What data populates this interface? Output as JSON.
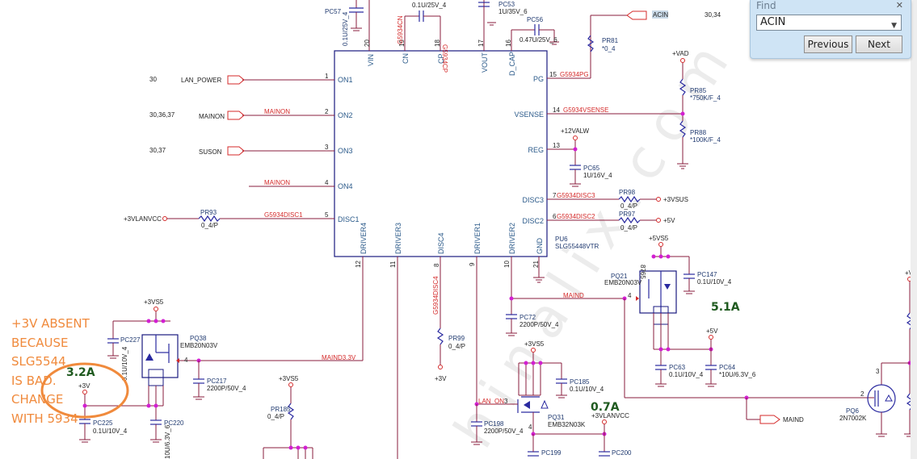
{
  "find_dialog": {
    "title": "Find",
    "close_label": "✕",
    "query": "ACIN",
    "dropdown_glyph": "▼",
    "previous_label": "Previous",
    "next_label": "Next"
  },
  "annotation": {
    "lines": [
      "+3V ABSENT",
      "BECAUSE",
      "SLG5544",
      "IS BAD.",
      "CHANGE",
      "WITH 5934"
    ],
    "accent_color": "#f08a3c"
  },
  "currents": {
    "pq38": "3.2A",
    "pq21": "5.1A",
    "pq31": "0.7A"
  },
  "ic": {
    "ref": "PU6",
    "part": "SLG55448VTR",
    "left_pins": [
      {
        "num": "1",
        "name": "ON1"
      },
      {
        "num": "2",
        "name": "ON2"
      },
      {
        "num": "3",
        "name": "ON3"
      },
      {
        "num": "4",
        "name": "ON4"
      },
      {
        "num": "5",
        "name": "DISC1"
      }
    ],
    "top_pins": [
      {
        "num": "20",
        "name": "VIN"
      },
      {
        "num": "19",
        "name": "CN"
      },
      {
        "num": "18",
        "name": "CP"
      },
      {
        "num": "17",
        "name": "VOUT"
      },
      {
        "num": "16",
        "name": "D_CAP"
      }
    ],
    "right_pins": [
      {
        "num": "15",
        "name": "PG"
      },
      {
        "num": "14",
        "name": "VSENSE"
      },
      {
        "num": "13",
        "name": "REG"
      },
      {
        "num": "7",
        "name": "DISC3"
      },
      {
        "num": "6",
        "name": "DISC2"
      }
    ],
    "bottom_pins": [
      {
        "num": "12",
        "name": "DRIVER4"
      },
      {
        "num": "11",
        "name": "DRIVER3"
      },
      {
        "num": "8",
        "name": "DISC4"
      },
      {
        "num": "9",
        "name": "DRIVER1"
      },
      {
        "num": "10",
        "name": "DRIVER2"
      },
      {
        "num": "21",
        "name": "GND"
      }
    ]
  },
  "ports": {
    "lan_power": {
      "name": "LAN_POWER",
      "pages": "30"
    },
    "mainon": {
      "name": "MAINON",
      "pages": "30,36,37"
    },
    "suson": {
      "name": "SUSON",
      "pages": "30,37"
    },
    "acin": {
      "name": "ACIN",
      "pages": "30,34"
    },
    "maind": {
      "name": "MAIND"
    }
  },
  "nets": {
    "mainon1": "MAINON",
    "mainon2": "MAINON",
    "disc1": "G5934DISC1",
    "cn": "G5934CN",
    "cp": "G5934CP",
    "pg": "G5934PG",
    "vsense": "G5934VSENSE",
    "disc3": "G5934DISC3",
    "disc2": "G5934DISC2",
    "disc4": "G5934DISC4",
    "maind": "MAIND",
    "maind33": "MAIND3.3V",
    "lan_on": "LAN_ON"
  },
  "rails": {
    "v3lanvcc_in": "+3VLANVCC",
    "vad": "+VAD",
    "v12valw": "+12VALW",
    "v3vsus": "+3VSUS",
    "v5": "+5V",
    "v5vs5": "+5VS5",
    "v3vs5_a": "+3VS5",
    "v3": "+3V",
    "v3vs5_b": "+3VS5",
    "v3_b": "+3V",
    "v3vs5_c": "+3VS5",
    "v3lanvcc_out": "+3VLANVCC",
    "v5_b": "+5V",
    "vplus": "+V"
  },
  "components": {
    "pc57": {
      "ref": "PC57",
      "value": "0.1U/25V_4"
    },
    "pc_cn": {
      "value": "0.1U/25V_4"
    },
    "pc53": {
      "ref": "PC53",
      "value": "1U/35V_6"
    },
    "pc56": {
      "ref": "PC56",
      "value": "0.47U/25V_6"
    },
    "pr81": {
      "ref": "PR81",
      "value": "*0_4"
    },
    "pr85": {
      "ref": "PR85",
      "value": "*750K/F_4"
    },
    "pr88": {
      "ref": "PR88",
      "value": "*100K/F_4"
    },
    "pc65": {
      "ref": "PC65",
      "value": "1U/16V_4"
    },
    "pr98": {
      "ref": "PR98",
      "value": "0_4/P"
    },
    "pr97": {
      "ref": "PR97",
      "value": "0_4/P"
    },
    "pr93": {
      "ref": "PR93",
      "value": "0_4/P"
    },
    "pr99": {
      "ref": "PR99",
      "value": "0_4/P"
    },
    "pc72": {
      "ref": "PC72",
      "value": "2200P/50V_4"
    },
    "pq21": {
      "ref": "PQ21",
      "value": "EMB20N03V"
    },
    "pc147": {
      "ref": "PC147",
      "value": "0.1U/10V_4"
    },
    "pc63": {
      "ref": "PC63",
      "value": "0.1U/10V_4"
    },
    "pc64": {
      "ref": "PC64",
      "value": "*10U/6.3V_6"
    },
    "pq38": {
      "ref": "PQ38",
      "value": "EMB20N03V"
    },
    "pc227": {
      "ref": "PC227",
      "value": "0.1U/10V_4"
    },
    "pc217": {
      "ref": "PC217",
      "value": "2200P/50V_4"
    },
    "pc225": {
      "ref": "PC225",
      "value": "0.1U/10V_4"
    },
    "pc220": {
      "ref": "PC220",
      "value": "10U/6.3V_6"
    },
    "pr185": {
      "ref": "PR185",
      "value": "0_4/P"
    },
    "pq31": {
      "ref": "PQ31",
      "value": "EMB32N03K"
    },
    "pc185": {
      "ref": "PC185",
      "value": "0.1U/10V_4"
    },
    "pc198": {
      "ref": "PC198",
      "value": "2200P/50V_4"
    },
    "pc199": {
      "ref": "PC199"
    },
    "pc200": {
      "ref": "PC200"
    },
    "pq6": {
      "ref": "PQ6",
      "value": "2N7002K"
    }
  },
  "watermark": "hinalix.com"
}
